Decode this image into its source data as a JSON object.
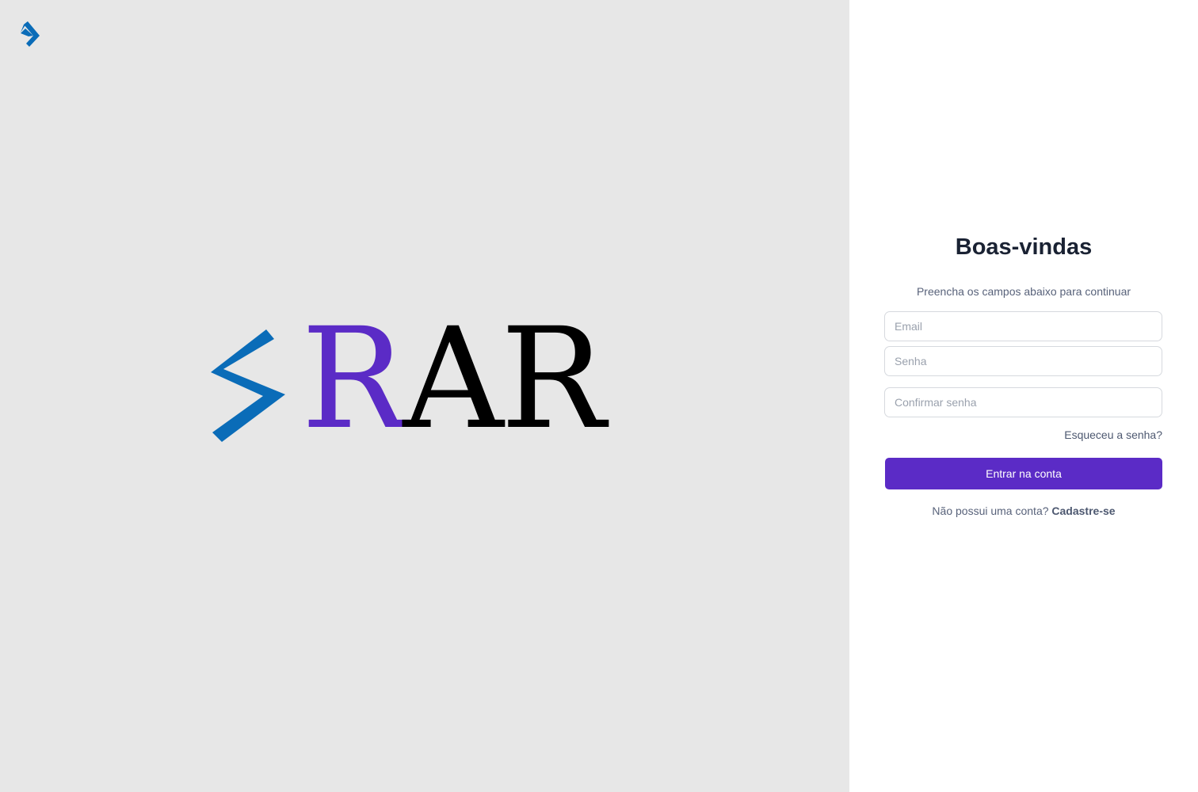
{
  "brand": {
    "wordmark_first": "R",
    "wordmark_rest": "AR",
    "bolt_icon": "lightning-bolt-icon",
    "colors": {
      "bolt": "#0a6cb8",
      "accent": "#5b2bc6",
      "text": "#000000",
      "left_bg": "#e7e7e7"
    }
  },
  "login": {
    "title": "Boas-vindas",
    "subtitle": "Preencha os campos abaixo para continuar",
    "email_placeholder": "Email",
    "password_placeholder": "Senha",
    "confirm_placeholder": "Confirmar senha",
    "forgot_label": "Esqueceu a senha?",
    "submit_label": "Entrar na conta",
    "signup_prompt": "Não possui uma conta?",
    "signup_link": "Cadastre-se"
  }
}
